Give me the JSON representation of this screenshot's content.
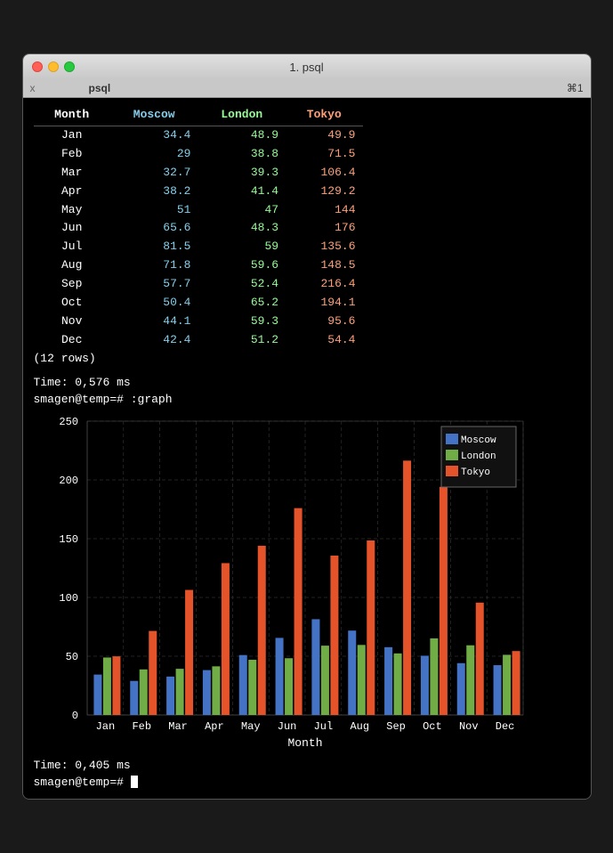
{
  "window": {
    "title": "1. psql"
  },
  "tabbar": {
    "close_label": "x",
    "tab_name": "psql",
    "shortcut": "⌘1"
  },
  "table": {
    "headers": [
      "Month",
      "Moscow",
      "London",
      "Tokyo"
    ],
    "rows": [
      [
        "Jan",
        "34.4",
        "48.9",
        "49.9"
      ],
      [
        "Feb",
        "29",
        "38.8",
        "71.5"
      ],
      [
        "Mar",
        "32.7",
        "39.3",
        "106.4"
      ],
      [
        "Apr",
        "38.2",
        "41.4",
        "129.2"
      ],
      [
        "May",
        "51",
        "47",
        "144"
      ],
      [
        "Jun",
        "65.6",
        "48.3",
        "176"
      ],
      [
        "Jul",
        "81.5",
        "59",
        "135.6"
      ],
      [
        "Aug",
        "71.8",
        "59.6",
        "148.5"
      ],
      [
        "Sep",
        "57.7",
        "52.4",
        "216.4"
      ],
      [
        "Oct",
        "50.4",
        "65.2",
        "194.1"
      ],
      [
        "Nov",
        "44.1",
        "59.3",
        "95.6"
      ],
      [
        "Dec",
        "42.4",
        "51.2",
        "54.4"
      ]
    ],
    "row_count": "(12 rows)"
  },
  "terminal": {
    "time1": "Time: 0,576 ms",
    "prompt1": "smagen@temp=# :graph",
    "time2": "Time: 0,405 ms",
    "prompt2": "smagen@temp=# "
  },
  "chart": {
    "title": "Month",
    "y_max": 250,
    "legend": [
      {
        "label": "Moscow",
        "color": "#4472c4"
      },
      {
        "label": "London",
        "color": "#70ad47"
      },
      {
        "label": "Tokyo",
        "color": "#e5532a"
      }
    ],
    "months": [
      "Jan",
      "Feb",
      "Mar",
      "Apr",
      "May",
      "Jun",
      "Jul",
      "Aug",
      "Sep",
      "Oct",
      "Nov",
      "Dec"
    ],
    "moscow": [
      34.4,
      29,
      32.7,
      38.2,
      51,
      65.6,
      81.5,
      71.8,
      57.7,
      50.4,
      44.1,
      42.4
    ],
    "london": [
      48.9,
      38.8,
      39.3,
      41.4,
      47,
      48.3,
      59,
      59.6,
      52.4,
      65.2,
      59.3,
      51.2
    ],
    "tokyo": [
      49.9,
      71.5,
      106.4,
      129.2,
      144,
      176,
      135.6,
      148.5,
      216.4,
      194.1,
      95.6,
      54.4
    ]
  }
}
